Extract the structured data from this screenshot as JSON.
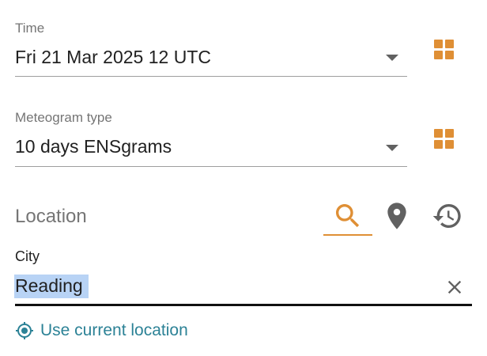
{
  "time_field": {
    "label": "Time",
    "value": "Fri 21 Mar 2025 12 UTC"
  },
  "meteogram_field": {
    "label": "Meteogram type",
    "value": "10 days ENSgrams"
  },
  "location": {
    "title": "Location",
    "tabs": [
      {
        "icon": "search-icon",
        "active": true
      },
      {
        "icon": "map-pin-icon",
        "active": false
      },
      {
        "icon": "history-icon",
        "active": false
      }
    ],
    "city_label": "City",
    "city_value": "Reading",
    "use_current_location": "Use current location"
  },
  "colors": {
    "accent": "#df8f35",
    "link": "#2c8296",
    "text_primary": "#212121",
    "text_secondary": "#757575",
    "selection": "#b8d3f5"
  }
}
